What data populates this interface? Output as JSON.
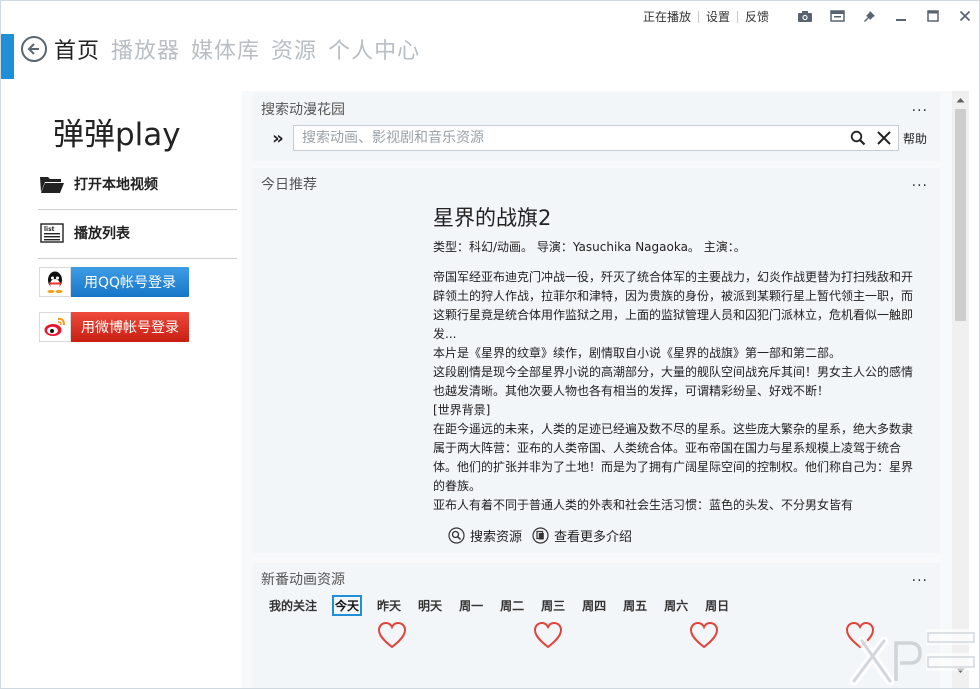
{
  "topbar": {
    "links": [
      "正在播放",
      "设置",
      "反馈"
    ],
    "icons": [
      "camera-icon",
      "window-icon",
      "pin-icon",
      "minimize-icon",
      "maximize-icon",
      "close-icon"
    ]
  },
  "nav": {
    "items": [
      "首页",
      "播放器",
      "媒体库",
      "资源",
      "个人中心"
    ],
    "active_index": 0
  },
  "sidebar": {
    "logo": "弹弹play",
    "open_local": "打开本地视频",
    "playlist": "播放列表",
    "qq_login": "用QQ帐号登录",
    "weibo_login": "用微博帐号登录"
  },
  "search": {
    "title": "搜索动漫花园",
    "placeholder": "搜索动画、影视剧和音乐资源",
    "help": "帮助",
    "more": "..."
  },
  "recommend": {
    "title": "今日推荐",
    "more": "...",
    "show_title": "星界的战旗2",
    "meta": "类型：科幻/动画。  导演：Yasuchika Nagaoka。  主演：。",
    "description": [
      "帝国军经亚布迪克门冲战一役，歼灭了统合体军的主要战力，幻炎作战更替为打扫残敌和开辟领土的狩人作战，拉菲尔和津特，因为贵族的身份，被派到某颗行星上暂代领主一职，而这颗行星竟是统合体用作监狱之用，上面的监狱管理人员和囚犯门派林立，危机看似一触即发...",
      "本片是《星界的纹章》续作，剧情取自小说《星界的战旗》第一部和第二部。",
      "这段剧情是现今全部星界小说的高潮部分，大量的舰队空间战充斥其间！男女主人公的感情也越发清晰。其他次要人物也各有相当的发挥，可谓精彩纷呈、好戏不断！",
      "[世界背景]",
      "在距今遥远的未来，人类的足迹已经遍及数不尽的星系。这些庞大繁杂的星系，绝大多数隶属于两大阵营：亚布的人类帝国、人类统合体。亚布帝国在国力与星系规模上凌驾于统合体。他们的扩张并非为了土地！而是为了拥有广阔星际空间的控制权。他们称自己为：星界的眷族。",
      "亚布人有着不同于普通人类的外表和社会生活习惯：蓝色的头发、不分男女皆有"
    ],
    "search_resources": "搜索资源",
    "more_info": "查看更多介绍"
  },
  "new_anime": {
    "title": "新番动画资源",
    "more": "...",
    "days": [
      "我的关注",
      "今天",
      "昨天",
      "明天",
      "周一",
      "周二",
      "周三",
      "周四",
      "周五",
      "周六",
      "周日"
    ],
    "selected_day": "今天"
  },
  "colors": {
    "accent": "#1f8fd8",
    "qq": "#1e7fd0",
    "weibo": "#d42a1c",
    "heart": "#e0443a"
  }
}
